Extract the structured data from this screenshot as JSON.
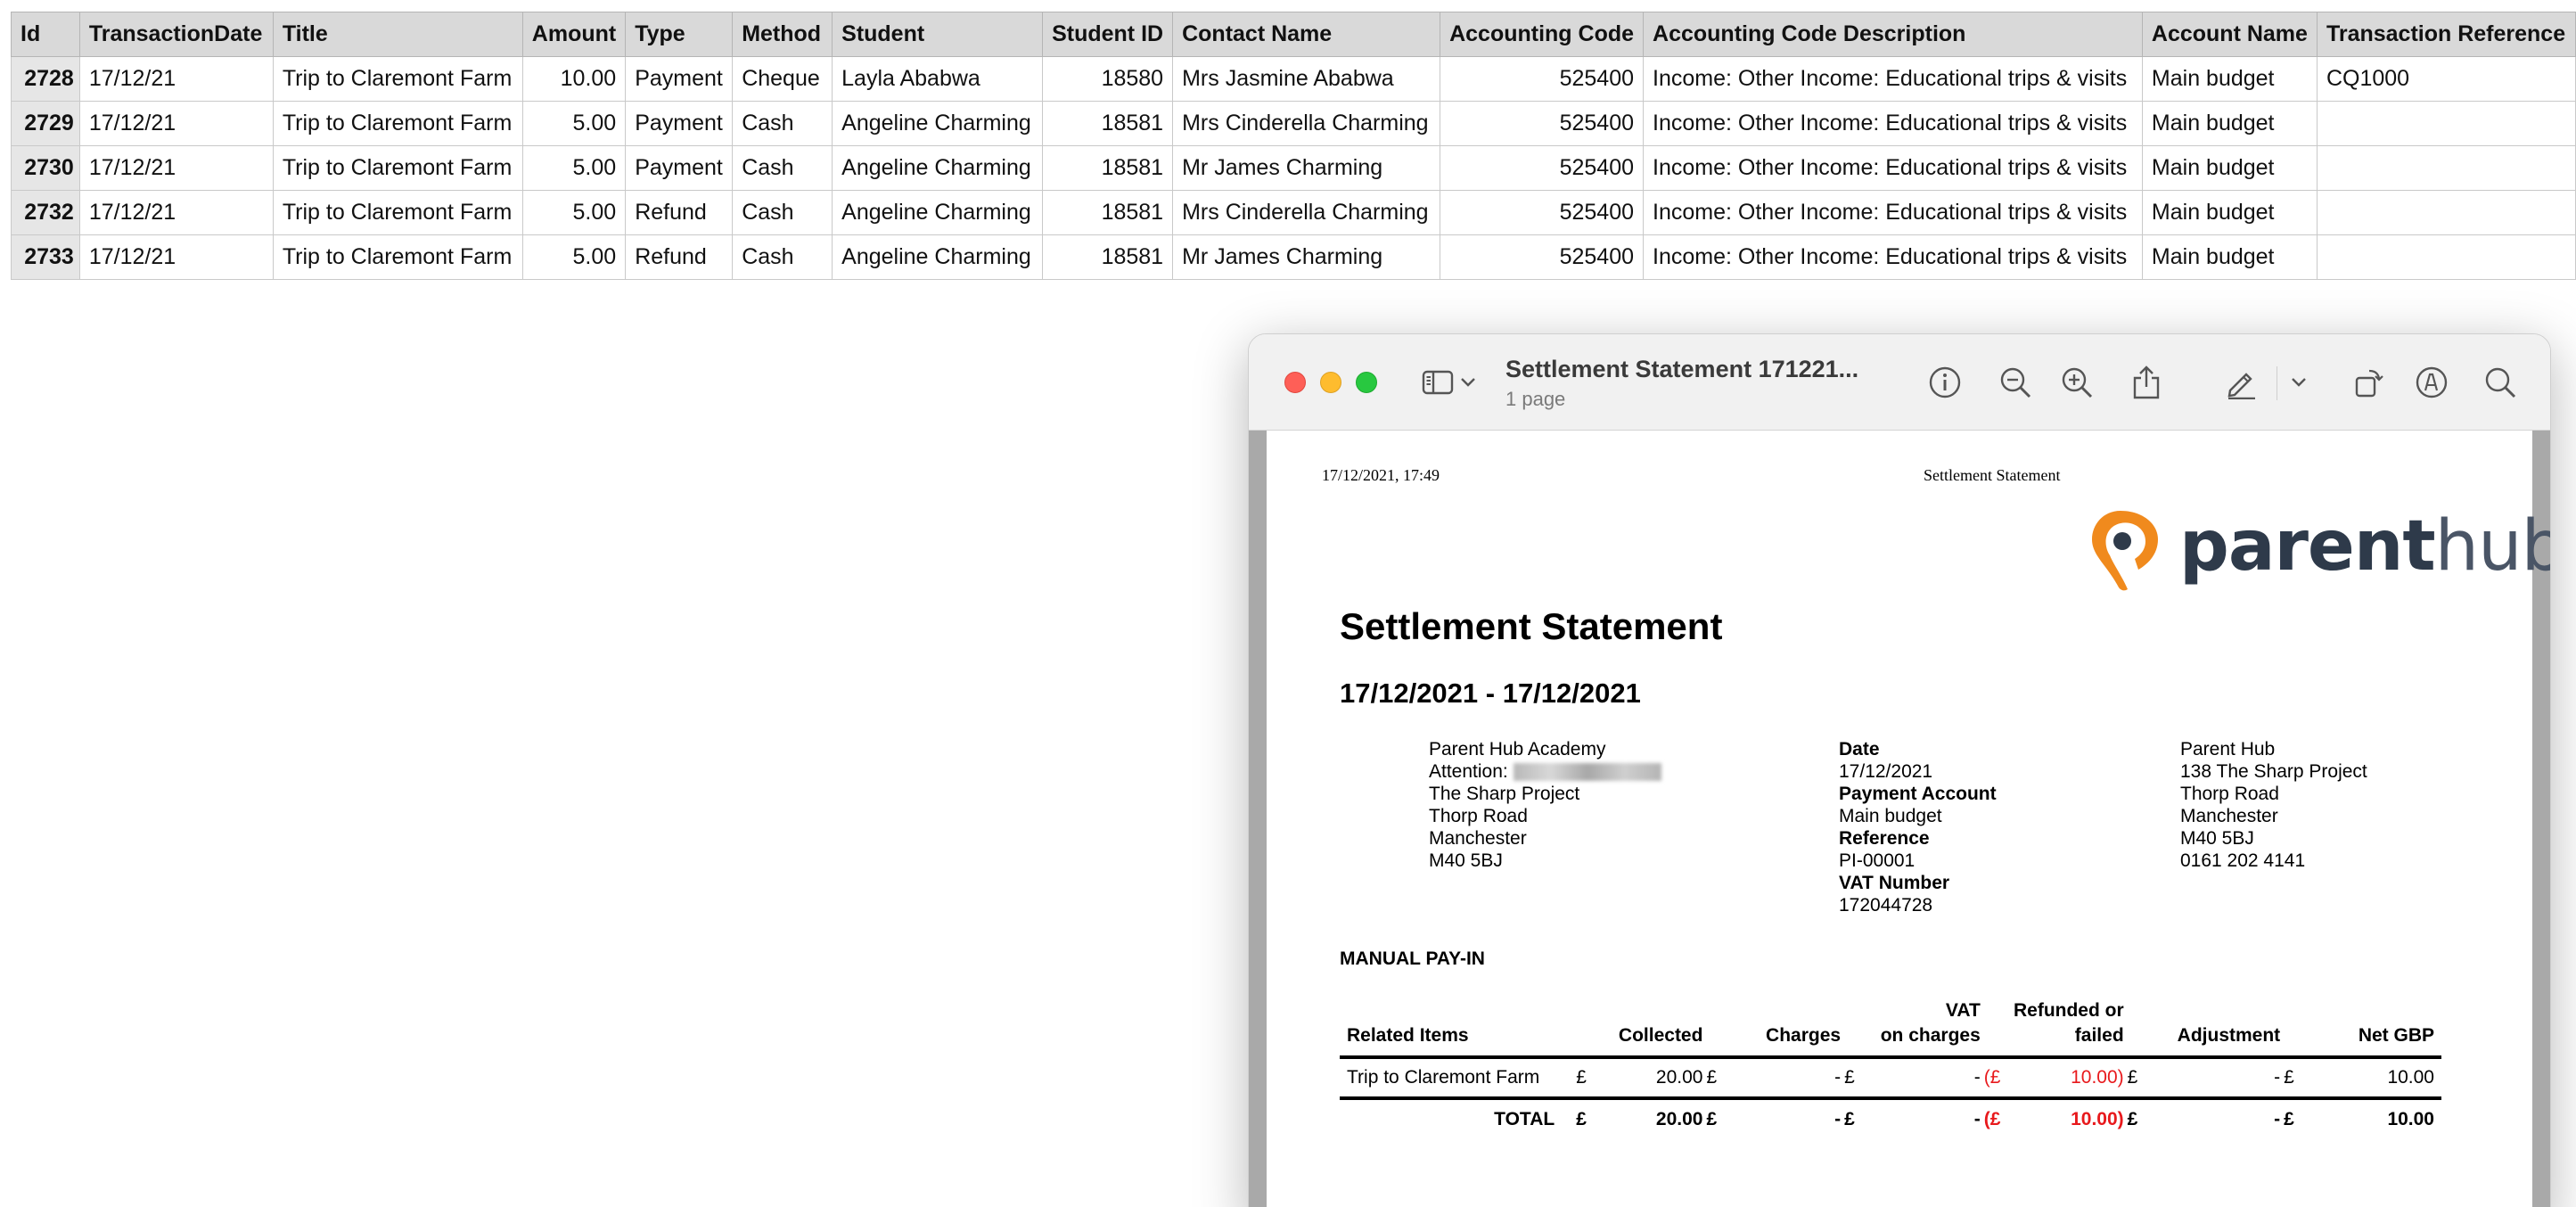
{
  "sheet": {
    "headers": [
      "Id",
      "TransactionDate",
      "Title",
      "Amount",
      "Type",
      "Method",
      "Student",
      "Student ID",
      "Contact Name",
      "Accounting Code",
      "Accounting Code Description",
      "Account Name",
      "Transaction Reference"
    ],
    "rows": [
      [
        "2728",
        "17/12/21",
        "Trip to Claremont Farm",
        "10.00",
        "Payment",
        "Cheque",
        "Layla Ababwa",
        "18580",
        "Mrs Jasmine Ababwa",
        "525400",
        "Income: Other Income: Educational trips & visits",
        "Main budget",
        "CQ1000"
      ],
      [
        "2729",
        "17/12/21",
        "Trip to Claremont Farm",
        "5.00",
        "Payment",
        "Cash",
        "Angeline Charming",
        "18581",
        "Mrs Cinderella Charming",
        "525400",
        "Income: Other Income: Educational trips & visits",
        "Main budget",
        ""
      ],
      [
        "2730",
        "17/12/21",
        "Trip to Claremont Farm",
        "5.00",
        "Payment",
        "Cash",
        "Angeline Charming",
        "18581",
        "Mr James Charming",
        "525400",
        "Income: Other Income: Educational trips & visits",
        "Main budget",
        ""
      ],
      [
        "2732",
        "17/12/21",
        "Trip to Claremont Farm",
        "5.00",
        "Refund",
        "Cash",
        "Angeline Charming",
        "18581",
        "Mrs Cinderella Charming",
        "525400",
        "Income: Other Income: Educational trips & visits",
        "Main budget",
        ""
      ],
      [
        "2733",
        "17/12/21",
        "Trip to Claremont Farm",
        "5.00",
        "Refund",
        "Cash",
        "Angeline Charming",
        "18581",
        "Mr James Charming",
        "525400",
        "Income: Other Income: Educational trips & visits",
        "Main budget",
        ""
      ]
    ]
  },
  "window": {
    "title": "Settlement Statement 171221...",
    "subtitle": "1 page",
    "icons": [
      "sidebar-icon",
      "chevron-down-icon",
      "info-icon",
      "zoom-out-icon",
      "zoom-in-icon",
      "share-icon",
      "markup-pen-icon",
      "chevron-down-icon",
      "rotate-icon",
      "annotate-icon",
      "search-icon"
    ]
  },
  "doc": {
    "print_date": "17/12/2021, 17:49",
    "print_title": "Settlement Statement",
    "logo": {
      "part1": "parent",
      "part2": "hub",
      "orange": "#f08a1d",
      "navy": "#2e3a4a"
    },
    "title": "Settlement Statement",
    "range": "17/12/2021 - 17/12/2021",
    "recipient": {
      "name": "Parent Hub Academy",
      "attention_label": "Attention:",
      "line1": "The Sharp Project",
      "line2": "Thorp Road",
      "city": "Manchester",
      "postcode": "M40 5BJ"
    },
    "details": {
      "date_label": "Date",
      "date": "17/12/2021",
      "account_label": "Payment Account",
      "account": "Main budget",
      "reference_label": "Reference",
      "reference": "PI-00001",
      "vat_label": "VAT Number",
      "vat": "172044728"
    },
    "sender": {
      "name": "Parent Hub",
      "line1": "138 The Sharp Project",
      "line2": "Thorp Road",
      "city": "Manchester",
      "postcode": "M40 5BJ",
      "phone": "0161 202 4141"
    },
    "section": "MANUAL PAY-IN",
    "table": {
      "headers": {
        "items": "Related Items",
        "collected": "Collected",
        "charges": "Charges",
        "vat1": "VAT",
        "vat2": "on charges",
        "refunded1": "Refunded or",
        "refunded2": "failed",
        "adjustment": "Adjustment",
        "net": "Net GBP"
      },
      "currency": "£",
      "refund_prefix": "(£",
      "item": {
        "name": "Trip to Claremont Farm",
        "collected": "20.00",
        "charges": "-",
        "vat": "-",
        "refunded": "10.00)",
        "adjustment": "-",
        "net": "10.00"
      },
      "total": {
        "label": "TOTAL",
        "collected": "20.00",
        "charges": "-",
        "vat": "-",
        "refunded": "10.00)",
        "adjustment": "-",
        "net": "10.00"
      },
      "negative_color": "#e8191c"
    }
  }
}
